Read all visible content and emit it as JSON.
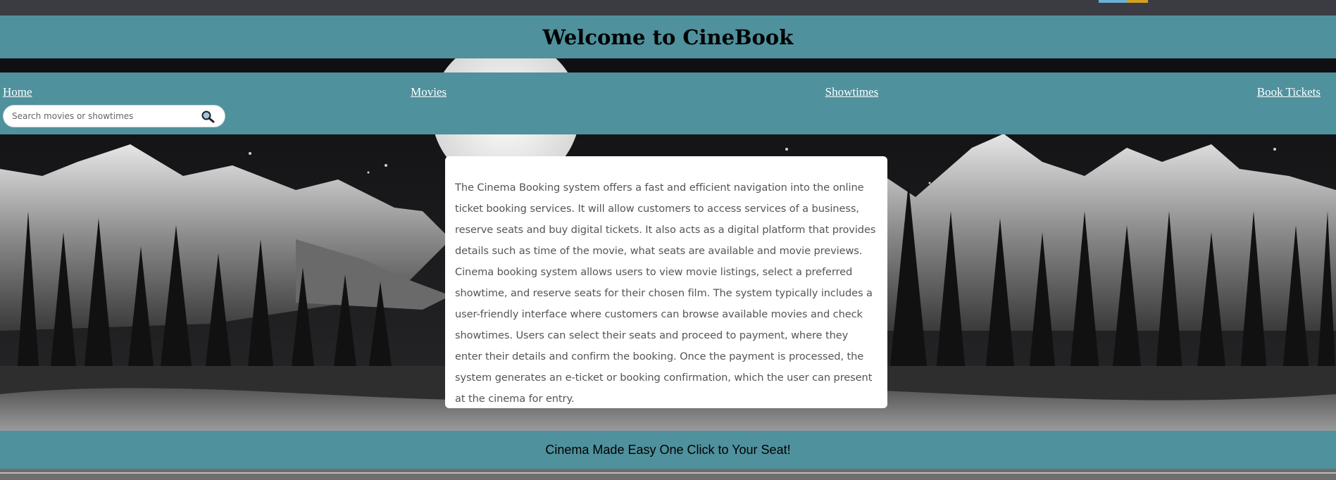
{
  "header": {
    "title": "Welcome to CineBook"
  },
  "nav": {
    "items": [
      {
        "label": "Home"
      },
      {
        "label": "Movies"
      },
      {
        "label": "Showtimes"
      },
      {
        "label": "Book Tickets"
      }
    ]
  },
  "search": {
    "placeholder": "Search movies or showtimes",
    "value": "",
    "icon": "search-icon"
  },
  "main": {
    "description": "The Cinema Booking system offers a fast and efficient navigation into the online ticket booking services. It will allow customers to access services of a business, reserve seats and buy digital tickets. It also acts as a digital platform that provides details such as time of the movie, what seats are available and movie previews. Cinema booking system allows users to view movie listings, select a preferred showtime, and reserve seats for their chosen film. The system typically includes a user-friendly interface where customers can browse available movies and check showtimes. Users can select their seats and proceed to payment, where they enter their details and confirm the booking. Once the payment is processed, the system generates an e-ticket or booking confirmation, which the user can present at the cinema for entry."
  },
  "footer": {
    "tagline": "Cinema Made Easy One Click to Your Seat!"
  },
  "colors": {
    "bar": "#4f919d",
    "card": "#ffffff",
    "nav_text": "#ffffff"
  }
}
